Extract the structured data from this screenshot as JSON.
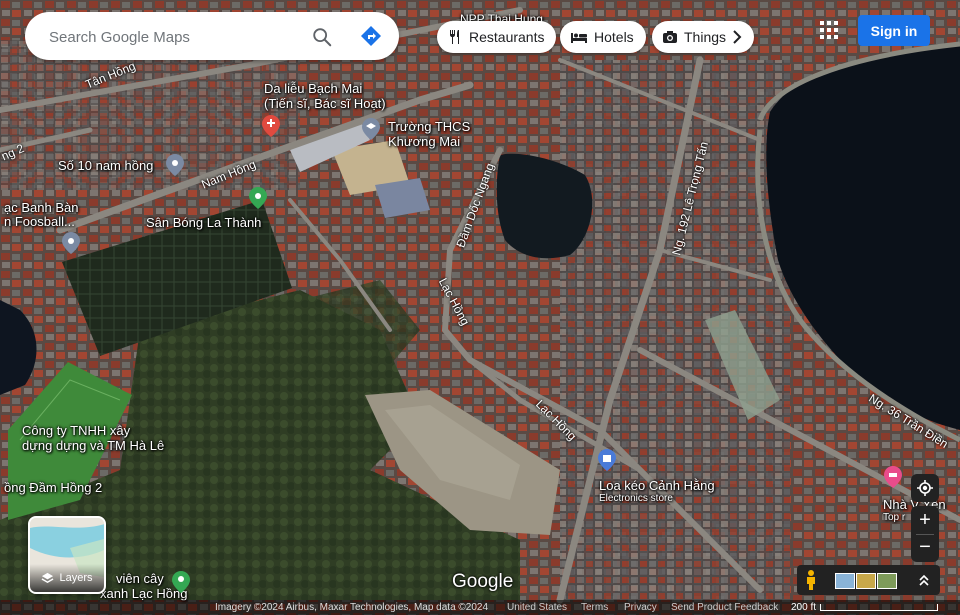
{
  "search": {
    "placeholder": "Search Google Maps",
    "search_icon": "search-icon",
    "directions_icon": "directions-icon"
  },
  "chips": [
    {
      "label": "Restaurants",
      "icon": "fork-knife-icon"
    },
    {
      "label": "Hotels",
      "icon": "bed-icon"
    },
    {
      "label": "Things",
      "icon": "camera-icon"
    }
  ],
  "header": {
    "signin_label": "Sign in",
    "apps_icon": "apps-grid-icon"
  },
  "places": {
    "npp": "NPP Thai Hung",
    "dalieu_1": "Da liễu Bạch Mai",
    "dalieu_2": "(Tiến sĩ, Bác sĩ Hoạt)",
    "truong_1": "Trường THCS",
    "truong_2": "Khương Mai",
    "so10": "Số 10 nam hồng",
    "banhban_1": "ạc Banh Bàn",
    "banhban_2": "n Foosball...",
    "sanbong": "Sân Bóng La Thành",
    "congty_1": "Công ty TNHH xây",
    "congty_2": "dựng dựng và TM Hà Lê",
    "damhong": "ồng Đầm Hồng 2",
    "loakeo": "Loa kéo Cảnh Hằng",
    "loakeo_sub": "Electronics store",
    "vienCay_1": "viên cây",
    "vienCay_2": "xanh Lạc Hồng",
    "nhavan_1": "Nhà V Yến",
    "nhavan_2": "Top r"
  },
  "streets": {
    "tanhong": "Tân Hồng",
    "namhong": "Nam Hồng",
    "ng2": "ng 2",
    "damdoc": "Đầm Dốc Ngang",
    "lachong1": "Lạc Hồng",
    "lachong2": "Lạc Hồng",
    "ng192": "Ng. 192 Lê Trọng Tấn",
    "ng36": "Ng. 36 Trần Điền"
  },
  "layers": {
    "label": "Layers",
    "icon": "layers-icon"
  },
  "controls": {
    "locate_icon": "my-location-icon",
    "zoom_in": "+",
    "zoom_out": "−",
    "pegman_icon": "pegman-icon",
    "expand_icon": "chevron-up-icon"
  },
  "footer": {
    "logo": "Google",
    "imagery": "Imagery ©2024 Airbus, Maxar Technologies, Map data ©2024",
    "country": "United States",
    "terms": "Terms",
    "privacy": "Privacy",
    "feedback": "Send Product Feedback",
    "scale": "200 ft"
  }
}
